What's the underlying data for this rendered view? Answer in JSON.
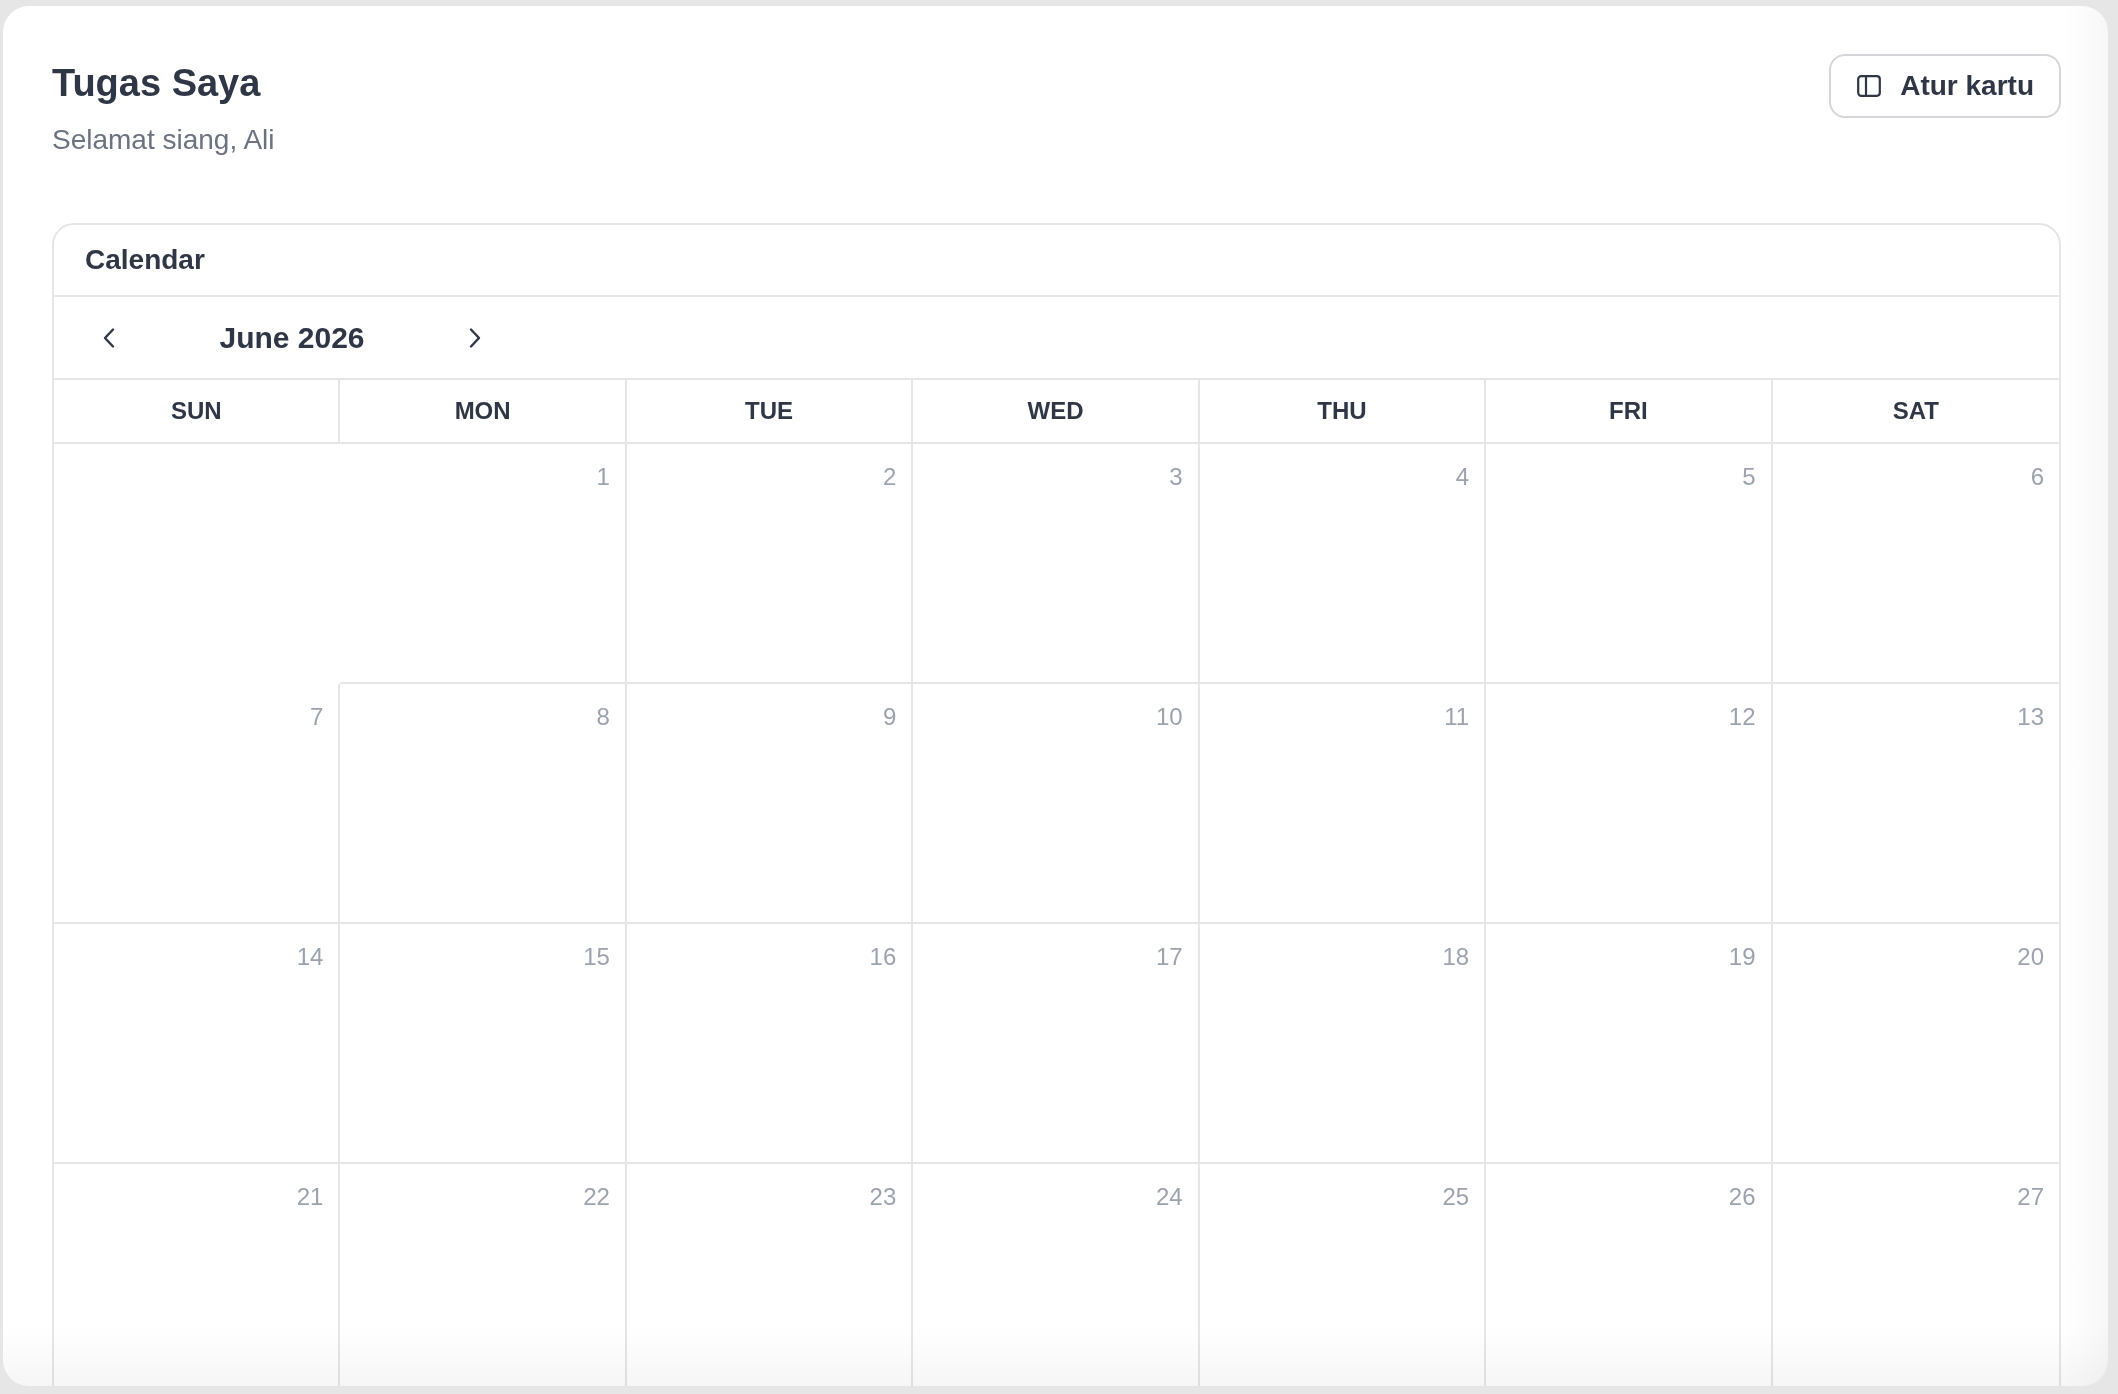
{
  "header": {
    "title": "Tugas Saya",
    "subtitle": "Selamat siang, Ali"
  },
  "arrange_button": {
    "label": "Atur kartu"
  },
  "calendar": {
    "title": "Calendar",
    "month": "June 2026",
    "weekdays": [
      "SUN",
      "MON",
      "TUE",
      "WED",
      "THU",
      "FRI",
      "SAT"
    ],
    "weeks": [
      {
        "days": [
          {
            "kind": "blank"
          },
          {
            "kind": "day",
            "label": "1"
          },
          {
            "kind": "day",
            "label": "2"
          },
          {
            "kind": "day",
            "label": "3"
          },
          {
            "kind": "day",
            "label": "4"
          },
          {
            "kind": "day",
            "label": "5"
          },
          {
            "kind": "day",
            "label": "6"
          }
        ]
      },
      {
        "days": [
          {
            "kind": "day",
            "label": "7"
          },
          {
            "kind": "day",
            "label": "8"
          },
          {
            "kind": "day",
            "label": "9"
          },
          {
            "kind": "day",
            "label": "10"
          },
          {
            "kind": "day",
            "label": "11"
          },
          {
            "kind": "day",
            "label": "12"
          },
          {
            "kind": "day",
            "label": "13"
          }
        ]
      },
      {
        "days": [
          {
            "kind": "day",
            "label": "14"
          },
          {
            "kind": "day",
            "label": "15"
          },
          {
            "kind": "day",
            "label": "16"
          },
          {
            "kind": "day",
            "label": "17"
          },
          {
            "kind": "day",
            "label": "18"
          },
          {
            "kind": "day",
            "label": "19"
          },
          {
            "kind": "day",
            "label": "20"
          }
        ]
      },
      {
        "days": [
          {
            "kind": "day",
            "label": "21"
          },
          {
            "kind": "day",
            "label": "22"
          },
          {
            "kind": "day",
            "label": "23"
          },
          {
            "kind": "day",
            "label": "24"
          },
          {
            "kind": "day",
            "label": "25"
          },
          {
            "kind": "day",
            "label": "26"
          },
          {
            "kind": "day",
            "label": "27"
          }
        ]
      }
    ]
  }
}
